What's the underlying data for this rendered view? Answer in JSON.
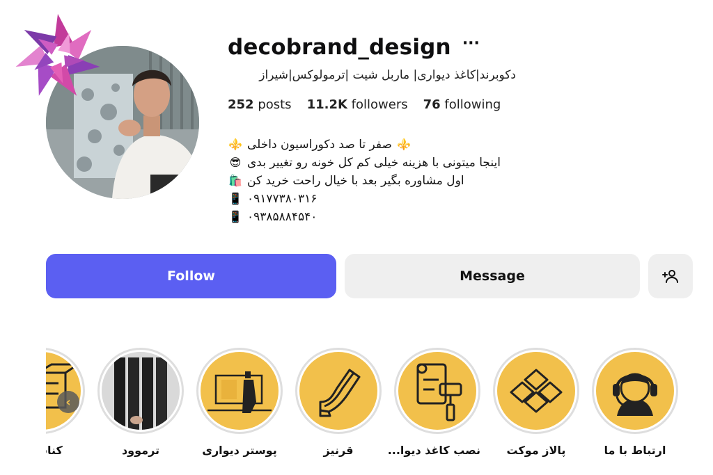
{
  "profile": {
    "username": "decobrand_design",
    "more_glyph": "···",
    "category": "دکوبرند|کاغذ دیواری| ماربل شیت |ترمولوکس|شیراز",
    "stats": {
      "posts_count": "252",
      "posts_label": "posts",
      "followers_count": "11.2K",
      "followers_label": "followers",
      "following_count": "76",
      "following_label": "following"
    },
    "bio": [
      {
        "emoji": "⚜️",
        "text": "صفر تا صد دکوراسیون داخلی",
        "emoji_end": "⚜️"
      },
      {
        "emoji": "😎",
        "text": "اینجا میتونی با هزینه خیلی کم کل خونه رو تغییر بدی"
      },
      {
        "emoji": "🛍️",
        "text": "اول مشاوره بگیر بعد با خیال راحت خرید کن"
      },
      {
        "emoji": "📱",
        "text": "۰۹۱۷۷۳۸۰۳۱۶"
      },
      {
        "emoji": "📱",
        "text": "۰۹۳۸۵۸۸۴۵۴۰"
      }
    ]
  },
  "actions": {
    "follow_label": "Follow",
    "message_label": "Message",
    "add_user_icon": "person-plus-icon"
  },
  "highlights": [
    {
      "label": "کناف ن",
      "icon": "drywall-icon"
    },
    {
      "label": "ترموود",
      "icon": "wood-panel-photo"
    },
    {
      "label": "پوستر دیواری",
      "icon": "wall-poster-icon"
    },
    {
      "label": "قرنیز",
      "icon": "molding-icon"
    },
    {
      "label": "نصب کاغذ دیوا...",
      "icon": "wallpaper-roll-icon"
    },
    {
      "label": "پالاز موکت",
      "icon": "floor-tiles-icon"
    },
    {
      "label": "ارتباط با ما",
      "icon": "headset-support-icon"
    }
  ],
  "colors": {
    "follow": "#5b5ff2",
    "highlight_bg": "#f2c04b",
    "secondary_button": "#efefef"
  }
}
